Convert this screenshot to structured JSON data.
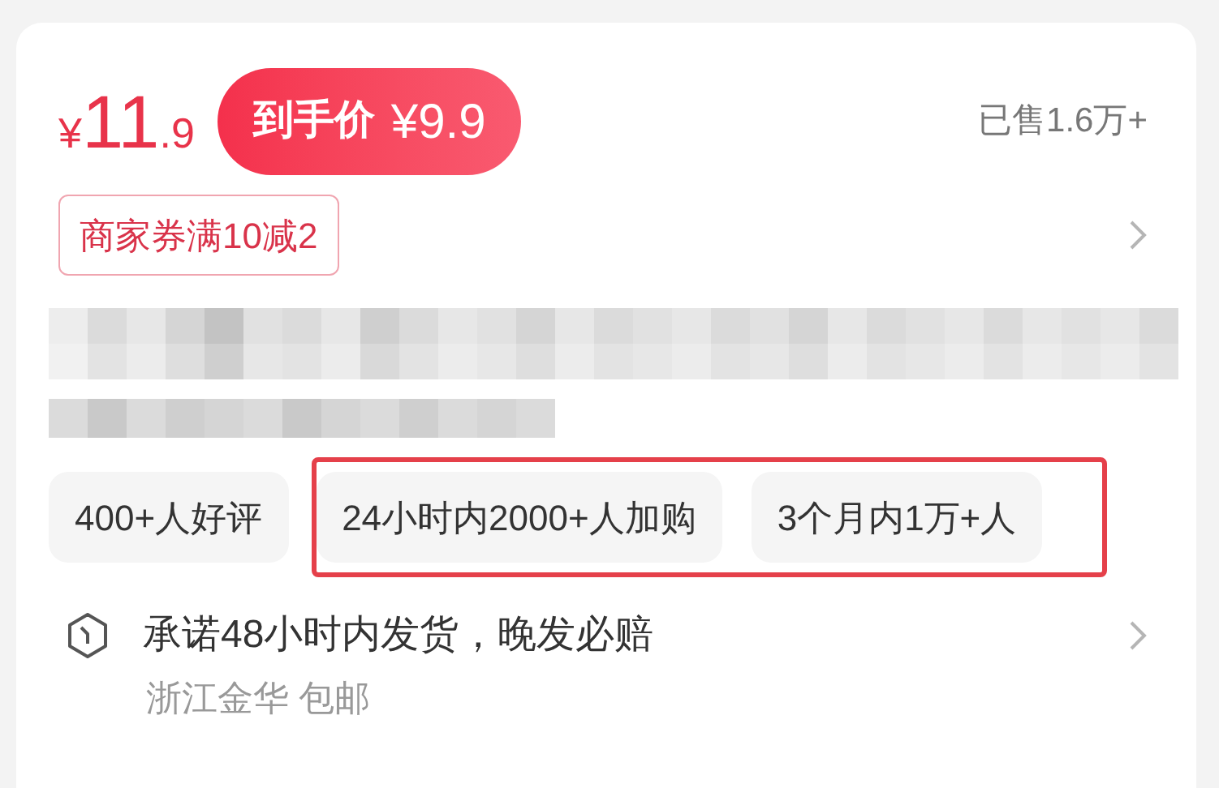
{
  "price": {
    "currency": "¥",
    "integer": "11",
    "decimal": ".9"
  },
  "final_price": {
    "label": "到手价",
    "currency": "¥",
    "amount": "9.9"
  },
  "sold": "已售1.6万+",
  "coupon": "商家券满10减2",
  "tags": [
    "400+人好评"
  ],
  "highlight_frame": {
    "tags": [
      "24小时内2000+人加购",
      "3个月内1万+人"
    ]
  },
  "shipping": {
    "promise": "承诺48小时内发货，晚发必赔",
    "origin": "浙江金华 包邮"
  }
}
